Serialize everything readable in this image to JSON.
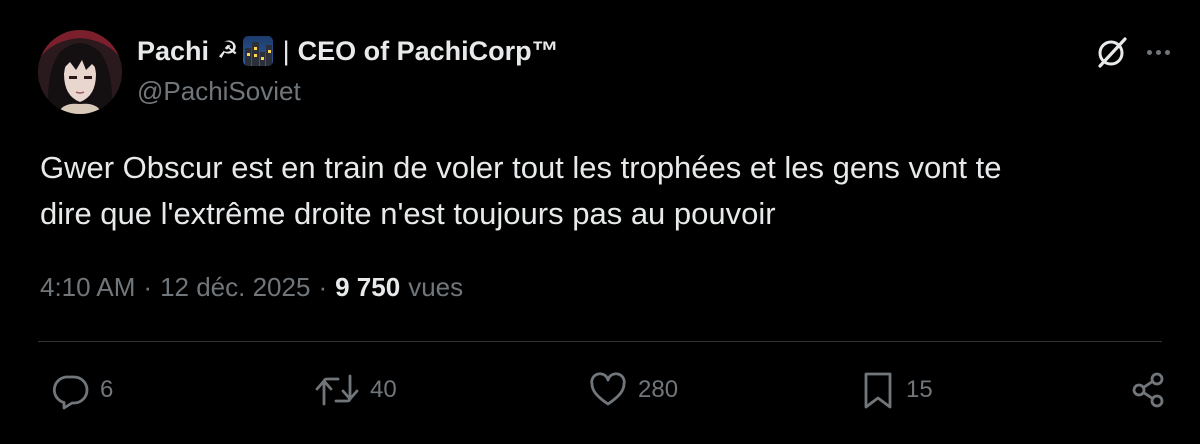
{
  "author": {
    "display_name": "Pachi",
    "emoji_sickle": "☭",
    "title_separator": "|",
    "title": "CEO of PachiCorp™",
    "handle": "@PachiSoviet"
  },
  "tweet": {
    "text_line1": "Gwer Obscur est en train de voler tout les trophées et les gens vont te",
    "text_line2": "dire que l'extrême droite n'est toujours pas au pouvoir"
  },
  "meta": {
    "time": "4:10 AM",
    "separator": "·",
    "date": "12 déc. 2025",
    "views_count": "9 750",
    "views_label": "vues"
  },
  "actions": {
    "replies": "6",
    "reposts": "40",
    "likes": "280",
    "bookmarks": "15"
  },
  "icons": {
    "header": [
      "grok-icon",
      "more-icon"
    ],
    "actions": [
      "reply-icon",
      "repost-icon",
      "like-icon",
      "bookmark-icon",
      "share-icon"
    ]
  },
  "colors": {
    "background": "#000000",
    "primary_text": "#e7e9ea",
    "secondary_text": "#71767b",
    "divider": "#2f3336"
  }
}
